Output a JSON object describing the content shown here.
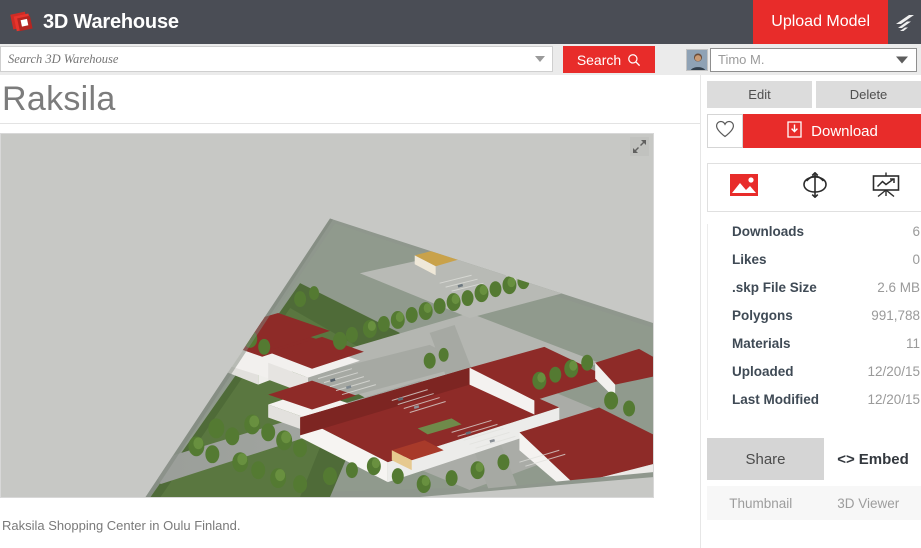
{
  "topbar": {
    "brand_label": "3D Warehouse",
    "brand_logo_icon": "warehouse-stack-logo-icon",
    "upload_label": "Upload Model",
    "sketchup_icon": "sketchup-logo-icon",
    "bg_color": "#4a4d55",
    "accent_color": "#e82c2a"
  },
  "search": {
    "placeholder": "Search 3D Warehouse",
    "value": "",
    "dropdown_icon": "chevron-down-icon",
    "button_label": "Search",
    "button_icon": "search-icon"
  },
  "account": {
    "avatar_icon": "user-avatar",
    "name": "Timo M.",
    "caret_icon": "chevron-down-icon"
  },
  "page": {
    "title": "Raksila",
    "caption": "Raksila Shopping Center in Oulu Finland.",
    "expand_icon": "expand-fullscreen-icon"
  },
  "actions": {
    "edit_label": "Edit",
    "delete_label": "Delete",
    "favorite_icon": "heart-outline-icon",
    "download_label": "Download",
    "download_icon": "download-box-icon"
  },
  "tabs": [
    {
      "name": "thumbnail-tab",
      "icon": "image-photo-icon",
      "active": true
    },
    {
      "name": "model-3d-tab",
      "icon": "3d-rotate-icon",
      "active": false
    },
    {
      "name": "stats-tab",
      "icon": "presentation-chart-icon",
      "active": false
    }
  ],
  "stats": [
    {
      "label": "Downloads",
      "value": "6"
    },
    {
      "label": "Likes",
      "value": "0"
    },
    {
      "label": ".skp File Size",
      "value": "2.6 MB"
    },
    {
      "label": "Polygons",
      "value": "991,788"
    },
    {
      "label": "Materials",
      "value": "11"
    },
    {
      "label": "Uploaded",
      "value": "12/20/15"
    },
    {
      "label": "Last Modified",
      "value": "12/20/15"
    }
  ],
  "share": {
    "share_label": "Share",
    "embed_label": "Embed",
    "embed_icon": "code-brackets-icon",
    "thumbnail_label": "Thumbnail",
    "viewer_label": "3D Viewer"
  },
  "model_image": {
    "description": "Aerial 3D model of Raksila shopping center with dark red roofs, white walls, gray parking lots, green trees and roads",
    "sky_color": "#c7c8c5",
    "roof_color": "#8e2b28",
    "wall_color": "#f2f0ee",
    "ground_color": "#9aa09b",
    "tree_color": "#5f7d3e",
    "pavement_color": "#b6b8b4"
  }
}
